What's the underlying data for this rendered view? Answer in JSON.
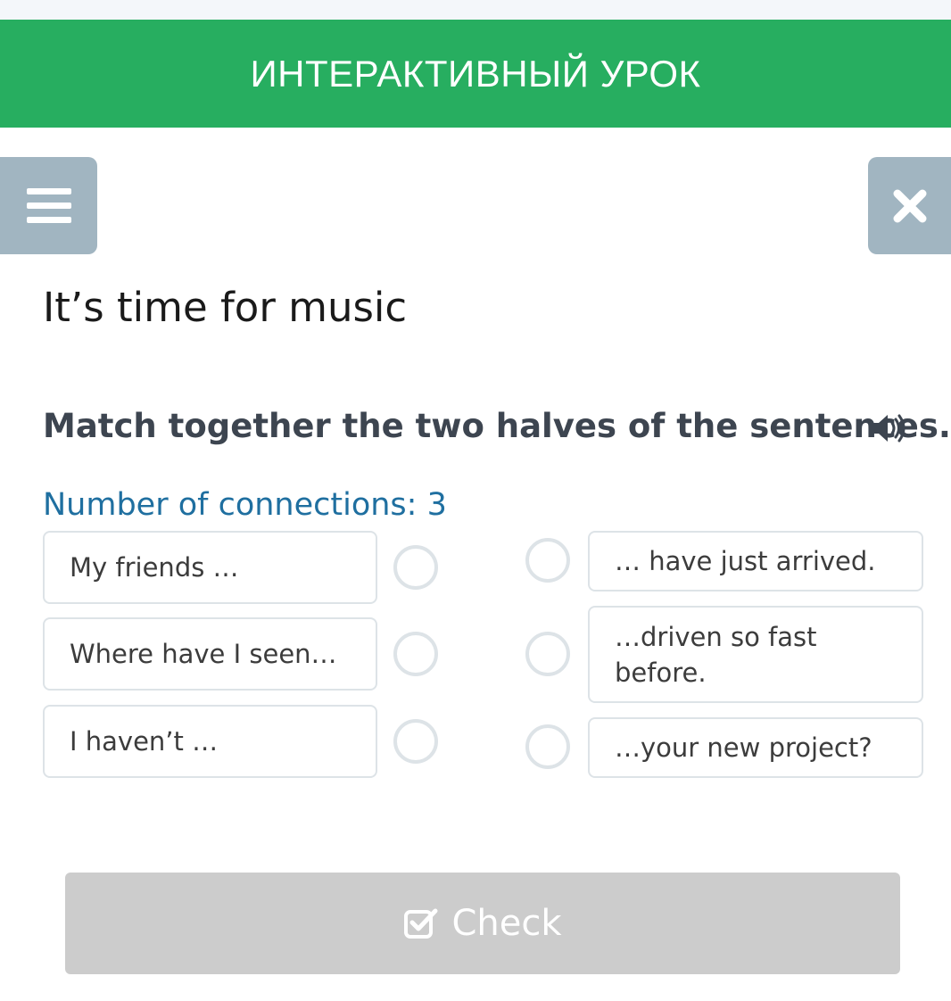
{
  "header": {
    "title": "ИНТЕРАКТИВНЫЙ УРОК",
    "color": "#27ae60"
  },
  "toolbar": {
    "menu_icon": "hamburger-icon",
    "close_icon": "close-icon"
  },
  "lesson": {
    "title": "It’s time for music"
  },
  "task": {
    "instruction": "Match together the two halves of the sentences.",
    "audio_icon": "speaker-icon",
    "connections_label": "Number of connections: 3"
  },
  "left_items": [
    {
      "text": "My friends …"
    },
    {
      "text": "Where have I seen…"
    },
    {
      "text": "I haven’t …"
    }
  ],
  "right_items": [
    {
      "text": "… have just arrived."
    },
    {
      "text": "…driven so fast before."
    },
    {
      "text": "…your new project?"
    }
  ],
  "actions": {
    "check_label": "Check",
    "check_icon": "checkbox-icon",
    "check_enabled": false
  }
}
